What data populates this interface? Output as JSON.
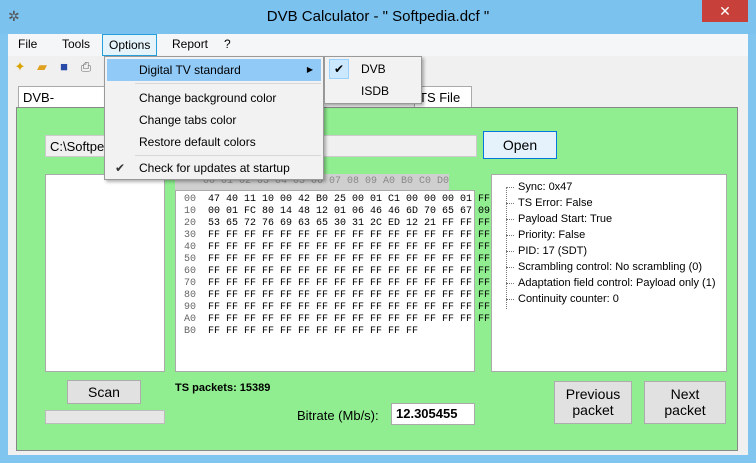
{
  "window": {
    "title": "DVB Calculator -  \" Softpedia.dcf \"",
    "close": "✕"
  },
  "menubar": {
    "file": "File",
    "tools": "Tools",
    "options": "Options",
    "report": "Report",
    "help": "?"
  },
  "tabs": {
    "tab1": "DVB-S/DSNG",
    "tab2": "TS File"
  },
  "path": {
    "value": "C:\\Softpe"
  },
  "open_button": "Open",
  "hex": {
    "header": "00 01 02 03 04 05 06 07 08 09 A0 B0 C0 D0 E0 F0",
    "rows": [
      {
        "off": "00",
        "data": "47 40 11 10 00 42 B0 25 00 01 C1 00 00 00 01 FF"
      },
      {
        "off": "10",
        "data": "00 01 FC 80 14 48 12 01 06 46 46 6D 70 65 67 09"
      },
      {
        "off": "20",
        "data": "53 65 72 76 69 63 65 30 31 2C ED 12 21 FF FF FF"
      },
      {
        "off": "30",
        "data": "FF FF FF FF FF FF FF FF FF FF FF FF FF FF FF FF"
      },
      {
        "off": "40",
        "data": "FF FF FF FF FF FF FF FF FF FF FF FF FF FF FF FF"
      },
      {
        "off": "50",
        "data": "FF FF FF FF FF FF FF FF FF FF FF FF FF FF FF FF"
      },
      {
        "off": "60",
        "data": "FF FF FF FF FF FF FF FF FF FF FF FF FF FF FF FF"
      },
      {
        "off": "70",
        "data": "FF FF FF FF FF FF FF FF FF FF FF FF FF FF FF FF"
      },
      {
        "off": "80",
        "data": "FF FF FF FF FF FF FF FF FF FF FF FF FF FF FF FF"
      },
      {
        "off": "90",
        "data": "FF FF FF FF FF FF FF FF FF FF FF FF FF FF FF FF"
      },
      {
        "off": "A0",
        "data": "FF FF FF FF FF FF FF FF FF FF FF FF FF FF FF FF"
      },
      {
        "off": "B0",
        "data": "FF FF FF FF FF FF FF FF FF FF FF FF"
      }
    ]
  },
  "info": [
    "Sync: 0x47",
    "TS Error: False",
    "Payload Start: True",
    "Priority: False",
    "PID: 17 (SDT)",
    "Scrambling control: No scrambling (0)",
    "Adaptation field control: Payload only (1)",
    "Continuity counter: 0"
  ],
  "scan_button": "Scan",
  "ts_packets": "TS packets: 15389",
  "bitrate": {
    "label": "Bitrate (Mb/s):",
    "value": "12.305455"
  },
  "prev_button": {
    "line1": "Previous",
    "line2": "packet"
  },
  "next_button": {
    "line1": "Next",
    "line2": "packet"
  },
  "options_menu": {
    "digital_tv": "Digital TV standard",
    "bg_color": "Change background color",
    "tabs_color": "Change tabs color",
    "restore": "Restore default colors",
    "updates": "Check for updates at startup"
  },
  "standard_submenu": {
    "dvb": "DVB",
    "isdb": "ISDB"
  },
  "colors": {
    "panel": "#90ee90",
    "title_bar": "#7cc2ef",
    "close": "#c7403a",
    "highlight": "#91c9f7"
  }
}
